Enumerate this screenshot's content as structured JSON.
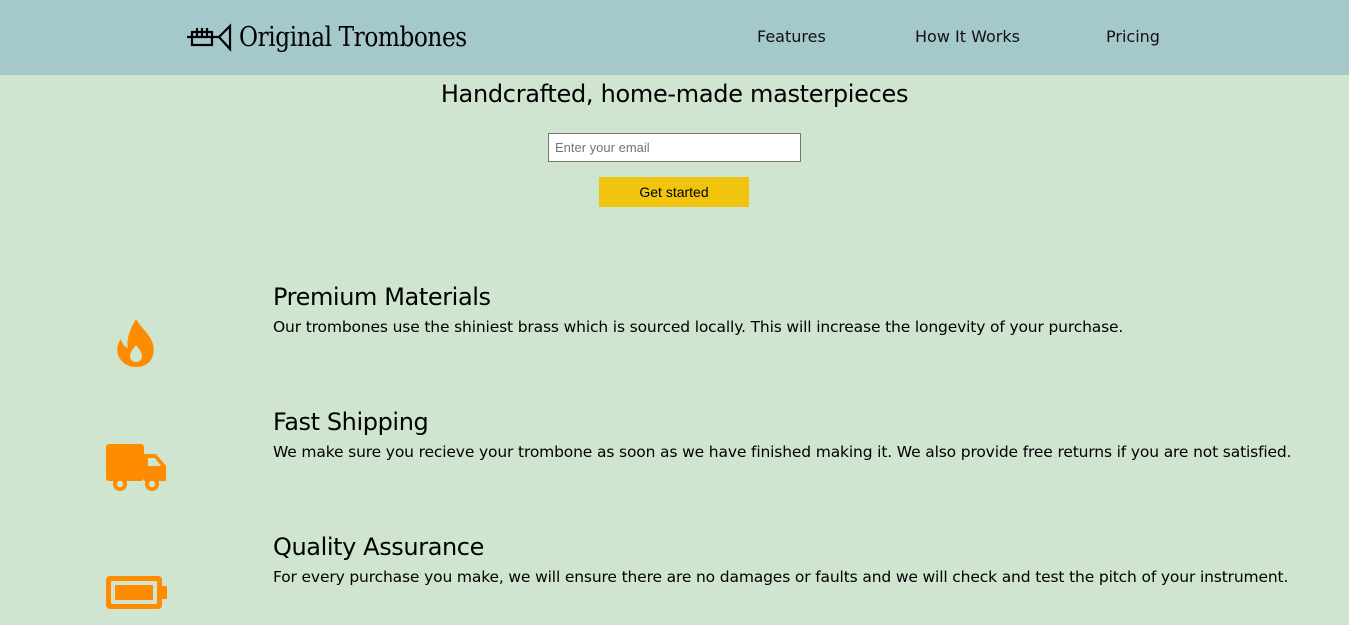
{
  "header": {
    "logo_text": "Original Trombones",
    "logo_icon": "trumpet-icon",
    "nav": [
      {
        "label": "Features"
      },
      {
        "label": "How It Works"
      },
      {
        "label": "Pricing"
      }
    ]
  },
  "hero": {
    "title": "Handcrafted, home-made masterpieces",
    "email_placeholder": "Enter your email",
    "button_label": "Get started"
  },
  "features": [
    {
      "icon": "fire-icon",
      "title": "Premium Materials",
      "text": "Our trombones use the shiniest brass which is sourced locally. This will increase the longevity of your purchase."
    },
    {
      "icon": "truck-icon",
      "title": "Fast Shipping",
      "text": "We make sure you recieve your trombone as soon as we have finished making it. We also provide free returns if you are not satisfied."
    },
    {
      "icon": "battery-icon",
      "title": "Quality Assurance",
      "text": "For every purchase you make, we will ensure there are no damages or faults and we will check and test the pitch of your instrument."
    }
  ],
  "colors": {
    "header_bg": "#a5c8ca",
    "page_bg": "#cfe5d0",
    "accent_button": "#f1c40f",
    "icon_orange": "#ff8c00"
  }
}
